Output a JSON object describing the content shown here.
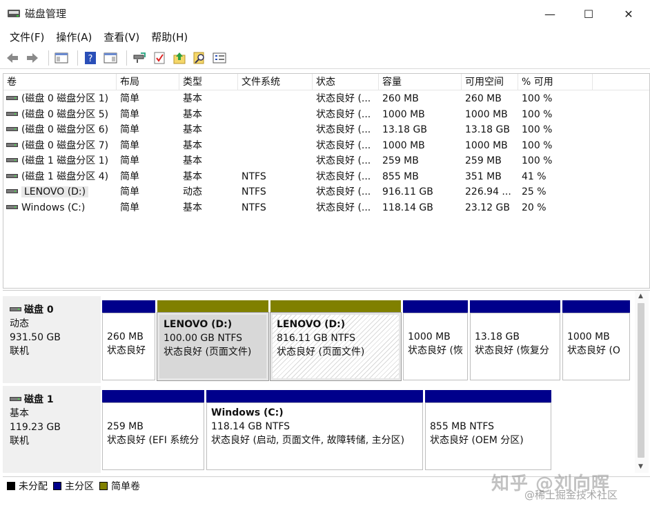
{
  "window": {
    "title": "磁盘管理",
    "minimize": "—",
    "maximize": "☐",
    "close": "✕"
  },
  "menu": [
    "文件(F)",
    "操作(A)",
    "查看(V)",
    "帮助(H)"
  ],
  "toolbar": {
    "icons": [
      "back-icon",
      "forward-icon",
      "console-tree-icon",
      "help-icon",
      "properties-icon",
      "connect-icon",
      "check-icon",
      "export-up-icon",
      "search-icon",
      "list-icon"
    ]
  },
  "volume_list": {
    "columns": [
      "卷",
      "布局",
      "类型",
      "文件系统",
      "状态",
      "容量",
      "可用空间",
      "% 可用"
    ],
    "rows": [
      [
        "(磁盘 0 磁盘分区 1)",
        "简单",
        "基本",
        "",
        "状态良好 (...",
        "260 MB",
        "260 MB",
        "100 %"
      ],
      [
        "(磁盘 0 磁盘分区 5)",
        "简单",
        "基本",
        "",
        "状态良好 (...",
        "1000 MB",
        "1000 MB",
        "100 %"
      ],
      [
        "(磁盘 0 磁盘分区 6)",
        "简单",
        "基本",
        "",
        "状态良好 (...",
        "13.18 GB",
        "13.18 GB",
        "100 %"
      ],
      [
        "(磁盘 0 磁盘分区 7)",
        "简单",
        "基本",
        "",
        "状态良好 (...",
        "1000 MB",
        "1000 MB",
        "100 %"
      ],
      [
        "(磁盘 1 磁盘分区 1)",
        "简单",
        "基本",
        "",
        "状态良好 (...",
        "259 MB",
        "259 MB",
        "100 %"
      ],
      [
        "(磁盘 1 磁盘分区 4)",
        "简单",
        "基本",
        "NTFS",
        "状态良好 (...",
        "855 MB",
        "351 MB",
        "41 %"
      ],
      [
        "LENOVO (D:)",
        "简单",
        "动态",
        "NTFS",
        "状态良好 (...",
        "916.11 GB",
        "226.94 ...",
        "25 %"
      ],
      [
        "Windows (C:)",
        "简单",
        "基本",
        "NTFS",
        "状态良好 (...",
        "118.14 GB",
        "23.12 GB",
        "20 %"
      ]
    ]
  },
  "disks": [
    {
      "name": "磁盘 0",
      "type": "动态",
      "size": "931.50 GB",
      "status": "联机",
      "partitions": [
        {
          "title": "",
          "line1": "260 MB",
          "line2": "状态良好",
          "color": "#00008b"
        },
        {
          "title": "LENOVO  (D:)",
          "line1": "100.00 GB NTFS",
          "line2": "状态良好 (页面文件)",
          "color": "#808000"
        },
        {
          "title": "LENOVO  (D:)",
          "line1": "816.11 GB NTFS",
          "line2": "状态良好 (页面文件)",
          "color": "#808000"
        },
        {
          "title": "",
          "line1": "1000 MB",
          "line2": "状态良好 (恢",
          "color": "#00008b"
        },
        {
          "title": "",
          "line1": "13.18 GB",
          "line2": "状态良好 (恢复分",
          "color": "#00008b"
        },
        {
          "title": "",
          "line1": "1000 MB",
          "line2": "状态良好 (O",
          "color": "#00008b"
        }
      ]
    },
    {
      "name": "磁盘 1",
      "type": "基本",
      "size": "119.23 GB",
      "status": "联机",
      "partitions": [
        {
          "title": "",
          "line1": "259 MB",
          "line2": "状态良好 (EFI 系统分",
          "color": "#00008b"
        },
        {
          "title": "Windows  (C:)",
          "line1": "118.14 GB NTFS",
          "line2": "状态良好 (启动, 页面文件, 故障转储, 主分区)",
          "color": "#00008b"
        },
        {
          "title": "",
          "line1": "855 MB NTFS",
          "line2": "状态良好 (OEM 分区)",
          "color": "#00008b"
        }
      ]
    }
  ],
  "legend": [
    {
      "label": "未分配",
      "color": "#000000"
    },
    {
      "label": "主分区",
      "color": "#00008b"
    },
    {
      "label": "简单卷",
      "color": "#808000"
    }
  ],
  "watermark": {
    "main": "知乎 @刘向晖",
    "sub": "@稀土掘金技术社区"
  }
}
